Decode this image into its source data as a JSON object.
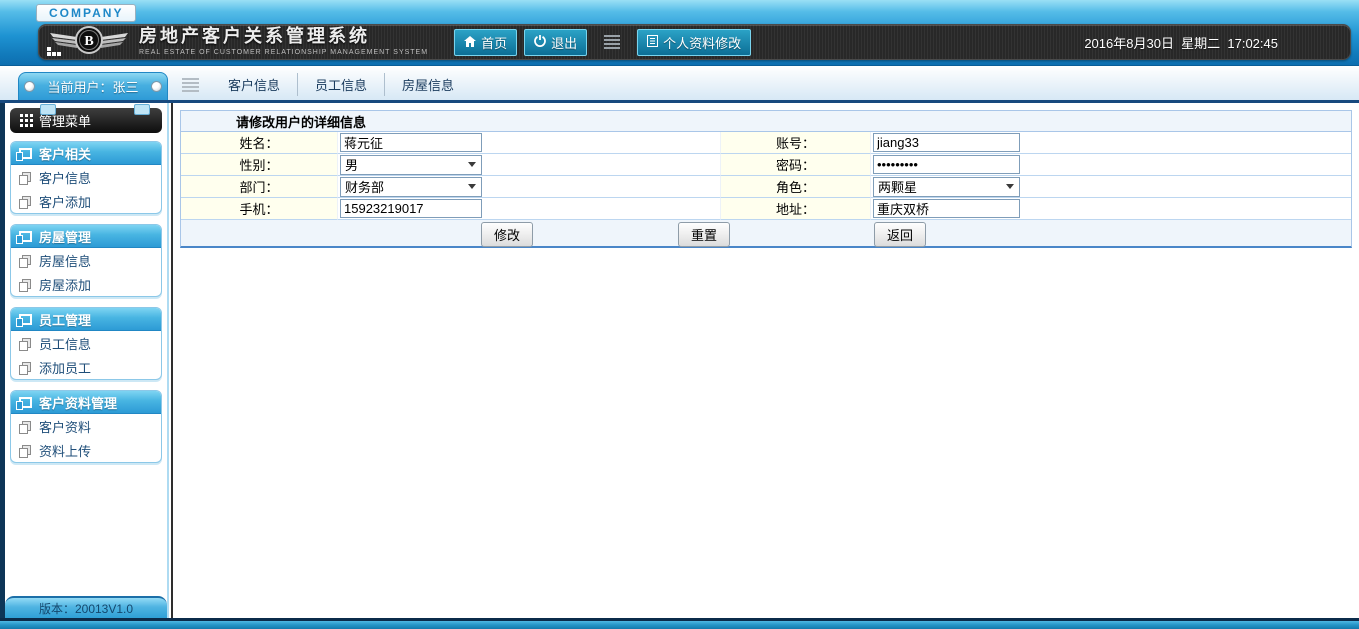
{
  "header": {
    "company_badge": "COMPANY",
    "title": "房地产客户关系管理系统",
    "subtitle": "REAL ESTATE OF CUSTOMER RELATIONSHIP MANAGEMENT SYSTEM",
    "nav": {
      "home": "首页",
      "logout": "退出",
      "profile": "个人资料修改"
    },
    "datetime": "2016年8月30日  星期二  17:02:45"
  },
  "subnav": {
    "current_user": "当前用户：张三",
    "links": [
      "客户信息",
      "员工信息",
      "房屋信息"
    ]
  },
  "sidebar": {
    "menu_title": "管理菜单",
    "sections": [
      {
        "title": "客户相关",
        "items": [
          "客户信息",
          "客户添加"
        ]
      },
      {
        "title": "房屋管理",
        "items": [
          "房屋信息",
          "房屋添加"
        ]
      },
      {
        "title": "员工管理",
        "items": [
          "员工信息",
          "添加员工"
        ]
      },
      {
        "title": "客户资料管理",
        "items": [
          "客户资料",
          "资料上传"
        ]
      }
    ],
    "version": "版本：20013V1.0"
  },
  "form": {
    "title": "请修改用户的详细信息",
    "fields": {
      "name": {
        "label": "姓名：",
        "value": "蒋元征"
      },
      "account": {
        "label": "账号：",
        "value": "jiang33"
      },
      "gender": {
        "label": "性别：",
        "value": "男"
      },
      "password": {
        "label": "密码：",
        "value": "•••••••••"
      },
      "department": {
        "label": "部门：",
        "value": "财务部"
      },
      "role": {
        "label": "角色：",
        "value": "两颗星"
      },
      "mobile": {
        "label": "手机：",
        "value": "15923219017"
      },
      "address": {
        "label": "地址：",
        "value": "重庆双桥"
      }
    },
    "buttons": {
      "modify": "修改",
      "reset": "重置",
      "back": "返回"
    }
  },
  "colors": {
    "header_blue": "#1E93D2",
    "band_dark": "#282828",
    "button_teal": "#0C6E95",
    "table_border": "#A9C6E8",
    "label_bg": "#FFFFEE",
    "footer_navy": "#0B2B4A",
    "footer_teal": "#2494C6"
  }
}
